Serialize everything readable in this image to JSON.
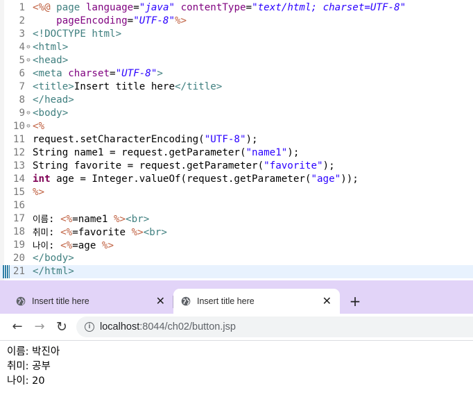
{
  "editor": {
    "lines": [
      {
        "num": "1",
        "fold": "",
        "tokens": [
          {
            "c": "jd",
            "t": "<%@ "
          },
          {
            "c": "tg",
            "t": "page"
          },
          {
            "c": "tx",
            "t": " "
          },
          {
            "c": "at",
            "t": "language"
          },
          {
            "c": "tx",
            "t": "="
          },
          {
            "c": "av",
            "t": "\"java\""
          },
          {
            "c": "tx",
            "t": " "
          },
          {
            "c": "at",
            "t": "contentType"
          },
          {
            "c": "tx",
            "t": "="
          },
          {
            "c": "av",
            "t": "\"text/html; charset=UTF-8\""
          }
        ]
      },
      {
        "num": "2",
        "fold": "",
        "tokens": [
          {
            "c": "tx",
            "t": "    "
          },
          {
            "c": "at",
            "t": "pageEncoding"
          },
          {
            "c": "tx",
            "t": "="
          },
          {
            "c": "av",
            "t": "\"UTF-8\""
          },
          {
            "c": "jd",
            "t": "%>"
          }
        ]
      },
      {
        "num": "3",
        "fold": "",
        "tokens": [
          {
            "c": "tg",
            "t": "<!DOCTYPE html>"
          }
        ]
      },
      {
        "num": "4",
        "fold": "⊖",
        "tokens": [
          {
            "c": "tg",
            "t": "<html>"
          }
        ]
      },
      {
        "num": "5",
        "fold": "⊖",
        "tokens": [
          {
            "c": "tg",
            "t": "<head>"
          }
        ]
      },
      {
        "num": "6",
        "fold": "",
        "tokens": [
          {
            "c": "tg",
            "t": "<meta "
          },
          {
            "c": "at",
            "t": "charset"
          },
          {
            "c": "tx",
            "t": "="
          },
          {
            "c": "av",
            "t": "\"UTF-8\""
          },
          {
            "c": "tg",
            "t": ">"
          }
        ]
      },
      {
        "num": "7",
        "fold": "",
        "tokens": [
          {
            "c": "tg",
            "t": "<title>"
          },
          {
            "c": "tx",
            "t": "Insert title here"
          },
          {
            "c": "tg",
            "t": "</title>"
          }
        ]
      },
      {
        "num": "8",
        "fold": "",
        "tokens": [
          {
            "c": "tg",
            "t": "</head>"
          }
        ]
      },
      {
        "num": "9",
        "fold": "⊖",
        "tokens": [
          {
            "c": "tg",
            "t": "<body>"
          }
        ]
      },
      {
        "num": "10",
        "fold": "⊖",
        "tokens": [
          {
            "c": "jd",
            "t": "<%"
          }
        ]
      },
      {
        "num": "11",
        "fold": "",
        "tokens": [
          {
            "c": "tx",
            "t": "request.setCharacterEncoding("
          },
          {
            "c": "st",
            "t": "\"UTF-8\""
          },
          {
            "c": "tx",
            "t": ");"
          }
        ]
      },
      {
        "num": "12",
        "fold": "",
        "tokens": [
          {
            "c": "tx",
            "t": "String name1 = request.getParameter("
          },
          {
            "c": "st",
            "t": "\"name1\""
          },
          {
            "c": "tx",
            "t": ");"
          }
        ]
      },
      {
        "num": "13",
        "fold": "",
        "tokens": [
          {
            "c": "tx",
            "t": "String favorite = request.getParameter("
          },
          {
            "c": "st",
            "t": "\"favorite\""
          },
          {
            "c": "tx",
            "t": ");"
          }
        ]
      },
      {
        "num": "14",
        "fold": "",
        "tokens": [
          {
            "c": "kw",
            "t": "int"
          },
          {
            "c": "tx",
            "t": " age = Integer.valueOf(request.getParameter("
          },
          {
            "c": "st",
            "t": "\"age\""
          },
          {
            "c": "tx",
            "t": "));"
          }
        ]
      },
      {
        "num": "15",
        "fold": "",
        "tokens": [
          {
            "c": "jd",
            "t": "%>"
          }
        ]
      },
      {
        "num": "16",
        "fold": "",
        "tokens": []
      },
      {
        "num": "17",
        "fold": "",
        "tokens": [
          {
            "c": "tx ko",
            "t": "이름"
          },
          {
            "c": "tx",
            "t": ": "
          },
          {
            "c": "jd",
            "t": "<%"
          },
          {
            "c": "tx",
            "t": "=name1 "
          },
          {
            "c": "jd",
            "t": "%>"
          },
          {
            "c": "tg",
            "t": "<br>"
          }
        ]
      },
      {
        "num": "18",
        "fold": "",
        "tokens": [
          {
            "c": "tx ko",
            "t": "취미"
          },
          {
            "c": "tx",
            "t": ": "
          },
          {
            "c": "jd",
            "t": "<%"
          },
          {
            "c": "tx",
            "t": "=favorite "
          },
          {
            "c": "jd",
            "t": "%>"
          },
          {
            "c": "tg",
            "t": "<br>"
          }
        ]
      },
      {
        "num": "19",
        "fold": "",
        "tokens": [
          {
            "c": "tx ko",
            "t": "나이"
          },
          {
            "c": "tx",
            "t": ": "
          },
          {
            "c": "jd",
            "t": "<%"
          },
          {
            "c": "tx",
            "t": "=age "
          },
          {
            "c": "jd",
            "t": "%>"
          }
        ]
      },
      {
        "num": "20",
        "fold": "",
        "tokens": [
          {
            "c": "tg",
            "t": "</body>"
          }
        ]
      },
      {
        "num": "21",
        "fold": "",
        "current": true,
        "tokens": [
          {
            "c": "tg",
            "t": "</html>"
          }
        ]
      }
    ]
  },
  "browser": {
    "tabs": [
      {
        "title": "Insert title here",
        "active": false
      },
      {
        "title": "Insert title here",
        "active": true
      }
    ],
    "close_glyph": "✕",
    "newtab_glyph": "+",
    "nav": {
      "back": "←",
      "forward": "→",
      "reload": "↻"
    },
    "info_glyph": "i",
    "url_host": "localhost",
    "url_rest": ":8044/ch02/button.jsp",
    "content": [
      "이름: 박진아",
      "취미: 공부",
      "나이: 20"
    ]
  },
  "colors": {
    "tabbar": "#e2d4f8",
    "tag": "#3f7f7f",
    "attr": "#7f007f",
    "attr_value": "#2a00ff",
    "jsp_delim": "#bf5f3f",
    "keyword": "#7f0055"
  }
}
